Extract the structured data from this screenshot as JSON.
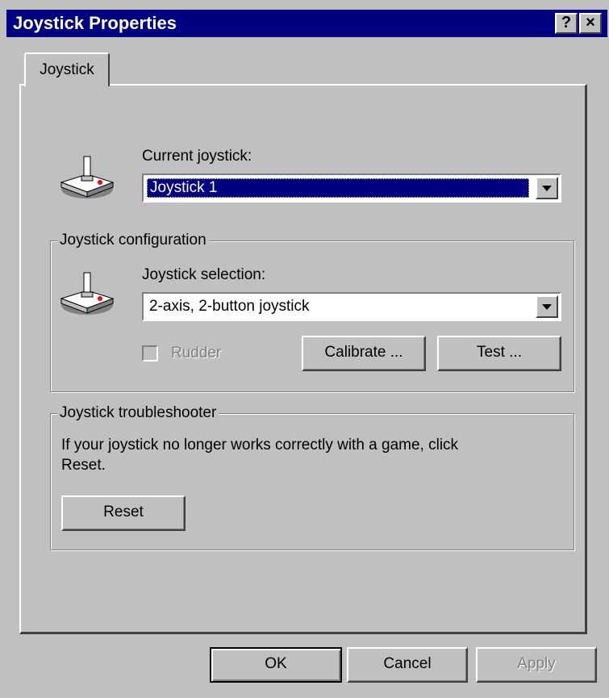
{
  "window": {
    "title": "Joystick Properties",
    "help_button": "?",
    "close_button": "×"
  },
  "tabs": [
    {
      "label": "Joystick"
    }
  ],
  "current": {
    "label": "Current joystick:",
    "value": "Joystick 1"
  },
  "configuration": {
    "legend": "Joystick configuration",
    "selection_label": "Joystick selection:",
    "selection_value": "2-axis, 2-button joystick",
    "rudder_label": "Rudder",
    "rudder_checked": false,
    "calibrate_label": "Calibrate ...",
    "test_label": "Test ..."
  },
  "troubleshooter": {
    "legend": "Joystick troubleshooter",
    "text_line1": "If your joystick no longer works correctly with a game, click",
    "text_line2": "Reset.",
    "reset_label": "Reset"
  },
  "footer": {
    "ok_label": "OK",
    "cancel_label": "Cancel",
    "apply_label": "Apply"
  },
  "icons": {
    "current": "joystick-icon",
    "configuration": "joystick-icon"
  },
  "colors": {
    "titlebar": "#000080",
    "face": "#c0c0c0",
    "selection": "#000080"
  }
}
